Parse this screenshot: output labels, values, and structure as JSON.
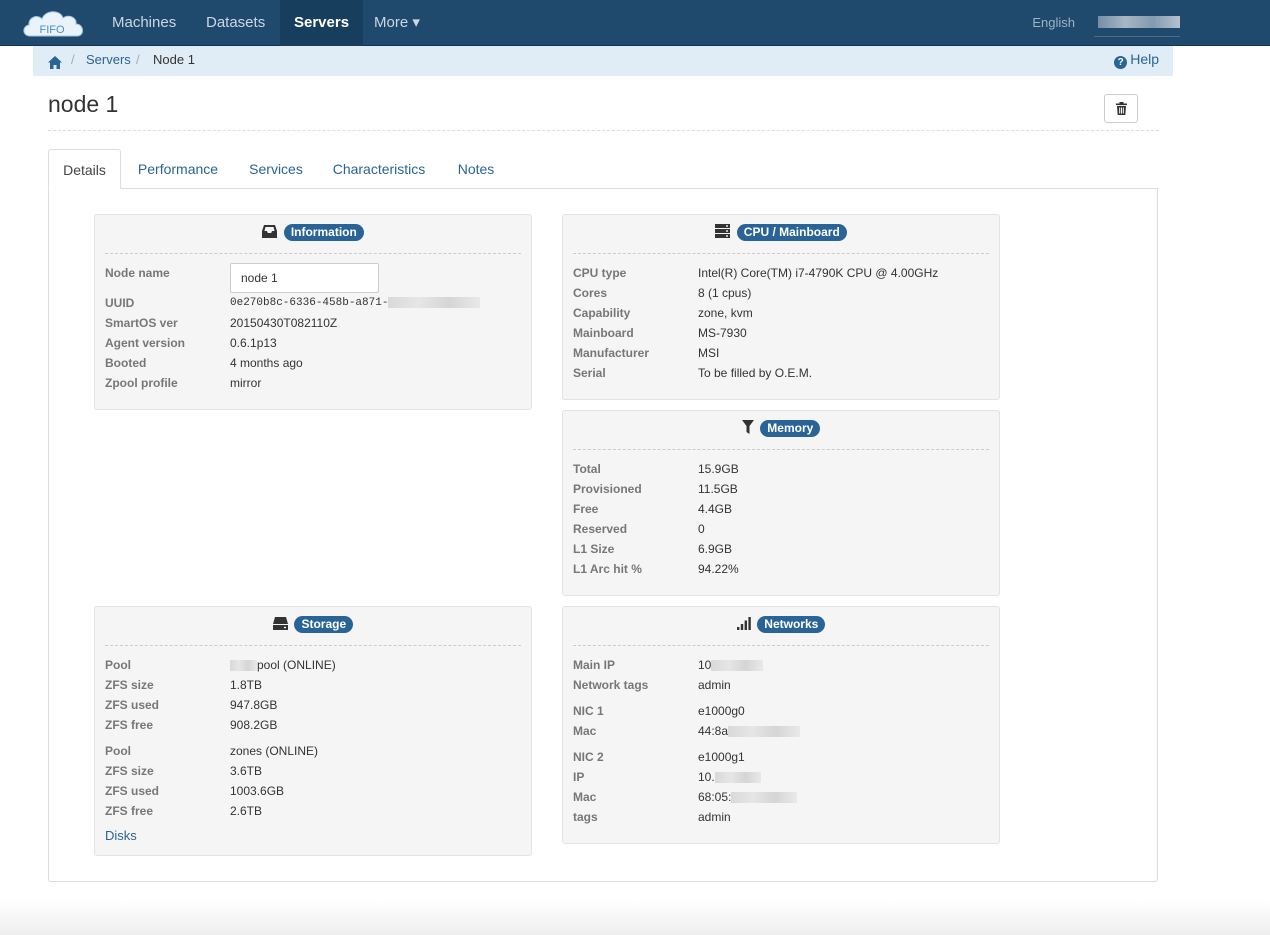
{
  "navbar": {
    "logo_text": "FIFO",
    "items": [
      {
        "label": "Machines"
      },
      {
        "label": "Datasets"
      },
      {
        "label": "Servers"
      },
      {
        "label": "More ▾"
      }
    ],
    "language": "English"
  },
  "breadcrumb": {
    "items": [
      "Servers",
      "Node 1"
    ],
    "separator": "/",
    "help": "Help"
  },
  "page": {
    "title": "node 1"
  },
  "tabs": [
    "Details",
    "Performance",
    "Services",
    "Characteristics",
    "Notes"
  ],
  "information": {
    "title": "Information",
    "node_name_label": "Node name",
    "node_name_value": "node 1",
    "rows": [
      {
        "label": "UUID",
        "value": "0e270b8c-6336-458b-a871-"
      },
      {
        "label": "SmartOS ver",
        "value": "20150430T082110Z"
      },
      {
        "label": "Agent version",
        "value": "0.6.1p13"
      },
      {
        "label": "Booted",
        "value": "4 months ago"
      },
      {
        "label": "Zpool profile",
        "value": "mirror"
      }
    ]
  },
  "cpu": {
    "title": "CPU / Mainboard",
    "rows": [
      {
        "label": "CPU type",
        "value": "Intel(R) Core(TM) i7-4790K CPU @ 4.00GHz"
      },
      {
        "label": "Cores",
        "value": "8 (1 cpus)"
      },
      {
        "label": "Capability",
        "value": "zone, kvm"
      },
      {
        "label": "Mainboard",
        "value": "MS-7930"
      },
      {
        "label": "Manufacturer",
        "value": "MSI"
      },
      {
        "label": "Serial",
        "value": "To be filled by O.E.M."
      }
    ]
  },
  "memory": {
    "title": "Memory",
    "rows": [
      {
        "label": "Total",
        "value": "15.9GB"
      },
      {
        "label": "Provisioned",
        "value": "11.5GB"
      },
      {
        "label": "Free",
        "value": "4.4GB"
      },
      {
        "label": "Reserved",
        "value": "0"
      },
      {
        "label": "L1 Size",
        "value": "6.9GB"
      },
      {
        "label": "L1 Arc hit %",
        "value": "94.22%"
      }
    ]
  },
  "storage": {
    "title": "Storage",
    "pool1": [
      {
        "label": "Pool",
        "value": "pool (ONLINE)"
      },
      {
        "label": "ZFS size",
        "value": "1.8TB"
      },
      {
        "label": "ZFS used",
        "value": "947.8GB"
      },
      {
        "label": "ZFS free",
        "value": "908.2GB"
      }
    ],
    "pool2": [
      {
        "label": "Pool",
        "value": "zones (ONLINE)"
      },
      {
        "label": "ZFS size",
        "value": "3.6TB"
      },
      {
        "label": "ZFS used",
        "value": "1003.6GB"
      },
      {
        "label": "ZFS free",
        "value": "2.6TB"
      }
    ],
    "disks_link": "Disks"
  },
  "networks": {
    "title": "Networks",
    "main": [
      {
        "label": "Main IP",
        "value": "10"
      },
      {
        "label": "Network tags",
        "value": "admin"
      }
    ],
    "nic1": [
      {
        "label": "NIC 1",
        "value": "e1000g0"
      },
      {
        "label": "Mac",
        "value": "44:8a"
      }
    ],
    "nic2": [
      {
        "label": "NIC 2",
        "value": "e1000g1"
      },
      {
        "label": "IP",
        "value": "10."
      },
      {
        "label": "Mac",
        "value": "68:05:"
      },
      {
        "label": "tags",
        "value": "admin"
      }
    ]
  },
  "colors": {
    "navbar": "#1f4a6e",
    "accent": "#2a6496",
    "breadcrumb_bg": "#e0ecf6",
    "panel_bg": "#f5f5f5"
  }
}
